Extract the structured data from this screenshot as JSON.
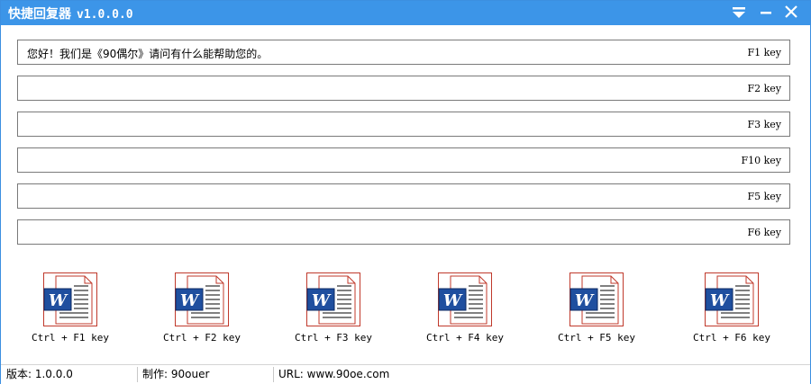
{
  "window": {
    "title": "快捷回复器",
    "version": "v1.0.0.0",
    "accent": "#3c95e8"
  },
  "titlebar_buttons": [
    {
      "name": "dropdown-menu-icon"
    },
    {
      "name": "minimize-icon"
    },
    {
      "name": "close-icon"
    }
  ],
  "replies": [
    {
      "text": "您好！我们是《90偶尔》请问有什么能帮助您的。",
      "key": "F1 key"
    },
    {
      "text": "",
      "key": "F2 key"
    },
    {
      "text": "",
      "key": "F3 key"
    },
    {
      "text": "",
      "key": "F10 key"
    },
    {
      "text": "",
      "key": "F5 key"
    },
    {
      "text": "",
      "key": "F6 key"
    }
  ],
  "shortcuts": [
    {
      "label": "Ctrl + F1 key",
      "icon": "word-document-icon"
    },
    {
      "label": "Ctrl + F2 key",
      "icon": "word-document-icon"
    },
    {
      "label": "Ctrl + F3 key",
      "icon": "word-document-icon"
    },
    {
      "label": "Ctrl + F4 key",
      "icon": "word-document-icon"
    },
    {
      "label": "Ctrl + F5 key",
      "icon": "word-document-icon"
    },
    {
      "label": "Ctrl + F6 key",
      "icon": "word-document-icon"
    }
  ],
  "status": {
    "version": "版本: 1.0.0.0",
    "author": "制作: 90ouer",
    "url": "URL: www.90oe.com"
  }
}
